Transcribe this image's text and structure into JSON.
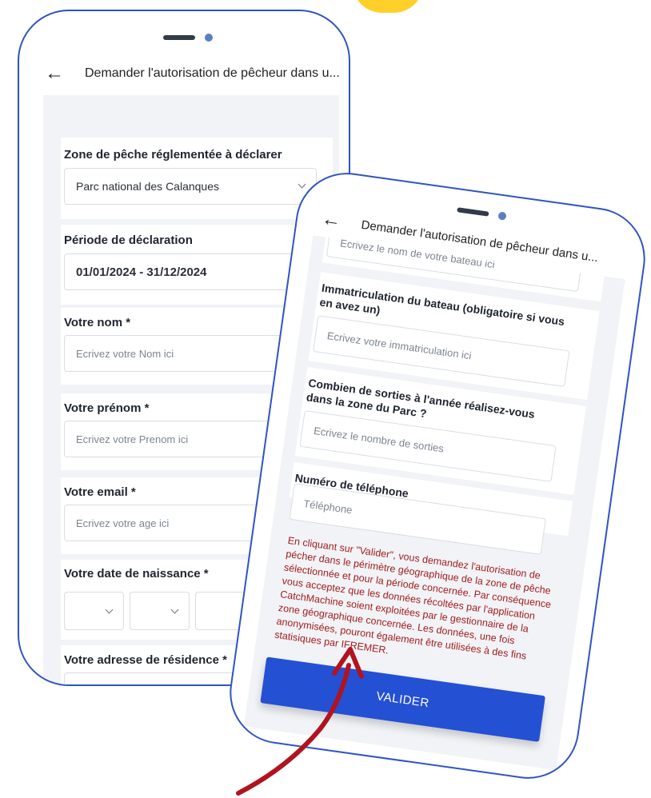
{
  "app_title": "Demander l'autorisation de pêcheur dans u...",
  "colors": {
    "accent": "#2450d4",
    "phone_border": "#2f53c4",
    "notice_text": "#a31d1d",
    "arrow": "#b0141e",
    "blob": "#ffd02a"
  },
  "icons": {
    "back": "arrow-left-icon",
    "dropdown": "chevron-down-icon",
    "pointer": "red-curved-arrow"
  },
  "screen1": {
    "zone": {
      "label": "Zone de pêche réglementée à déclarer",
      "value": "Parc national des Calanques"
    },
    "period": {
      "label": "Période de déclaration",
      "value": "01/01/2024 - 31/12/2024"
    },
    "nom": {
      "label": "Votre nom *",
      "placeholder": "Ecrivez votre Nom ici"
    },
    "prenom": {
      "label": "Votre prénom *",
      "placeholder": "Ecrivez votre Prenom ici"
    },
    "email": {
      "label": "Votre email *",
      "placeholder": "Ecrivez votre age ici"
    },
    "birthdate": {
      "label": "Votre date de naissance *"
    },
    "address": {
      "label": "Votre adresse de résidence *"
    }
  },
  "screen2": {
    "boat_name_partial": "Ecrivez le nom de votre bateau ici",
    "immat": {
      "label": "Immatriculation du bateau (obligatoire si vous en avez un)",
      "placeholder": "Ecrivez votre immatriculation ici"
    },
    "sorties": {
      "label": "Combien de sorties à l'année réalisez-vous dans la zone du Parc ?",
      "placeholder": "Ecrivez le nombre de sorties"
    },
    "phone": {
      "label": "Numéro de téléphone",
      "placeholder": "Téléphone"
    },
    "notice": "En cliquant sur \"Valider\", vous demandez l'autorisation de pécher dans le périmètre géographique de la zone de pêche sélectionnée et pour la période concernée. Par conséquence vous acceptez que les données récoltées par l'application CatchMachine soient exploitées par le gestionnaire de la zone géographique concernée. Les données, une fois anonymisées, pouront également être utilisées à des fins statisiques par IFREMER.",
    "validate_label": "VALIDER"
  }
}
